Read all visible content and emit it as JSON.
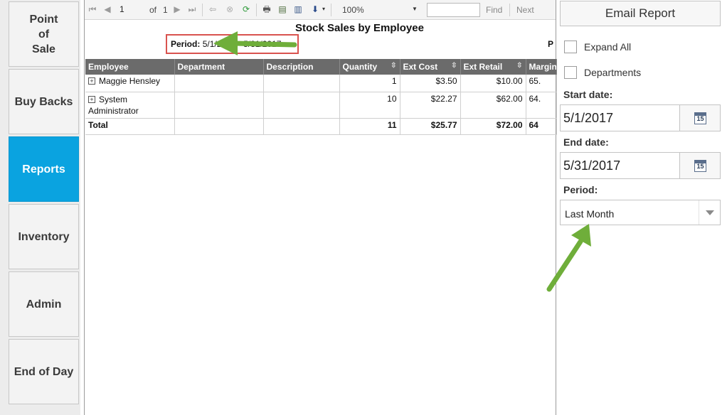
{
  "nav": {
    "items": [
      {
        "label": "Point\nof\nSale"
      },
      {
        "label": "Buy Backs"
      },
      {
        "label": "Reports",
        "active": true
      },
      {
        "label": "Inventory"
      },
      {
        "label": "Admin"
      },
      {
        "label": "End of Day"
      }
    ]
  },
  "toolbar": {
    "page_current": "1",
    "page_of": "of",
    "page_total": "1",
    "zoom": "100%",
    "find_value": "",
    "find_label": "Find",
    "next_label": "Next"
  },
  "report": {
    "title": "Stock Sales by Employee",
    "period_label": "Period:",
    "period_value": "5/1/2017 - 5/31/2017",
    "corner_text": "P",
    "columns": [
      "Employee",
      "Department",
      "Description",
      "Quantity",
      "Ext Cost",
      "Ext Retail",
      "Margin"
    ],
    "rows": [
      {
        "employee": "Maggie Hensley",
        "department": "",
        "description": "",
        "quantity": "1",
        "ext_cost": "$3.50",
        "ext_retail": "$10.00",
        "margin": "65."
      },
      {
        "employee": "System Administrator",
        "department": "",
        "description": "",
        "quantity": "10",
        "ext_cost": "$22.27",
        "ext_retail": "$62.00",
        "margin": "64."
      }
    ],
    "total": {
      "label": "Total",
      "quantity": "11",
      "ext_cost": "$25.77",
      "ext_retail": "$72.00",
      "margin": "64"
    }
  },
  "panel": {
    "email_label": "Email Report",
    "expand_all_label": "Expand All",
    "departments_label": "Departments",
    "start_date_label": "Start date:",
    "start_date_value": "5/1/2017",
    "end_date_label": "End date:",
    "end_date_value": "5/31/2017",
    "calendar_day": "15",
    "period_label": "Period:",
    "period_value": "Last Month"
  },
  "colors": {
    "nav_active": "#0aa3e0",
    "highlight_box": "#d9534f",
    "arrow": "#6fae3a",
    "header_bg": "#6b6b6b"
  }
}
